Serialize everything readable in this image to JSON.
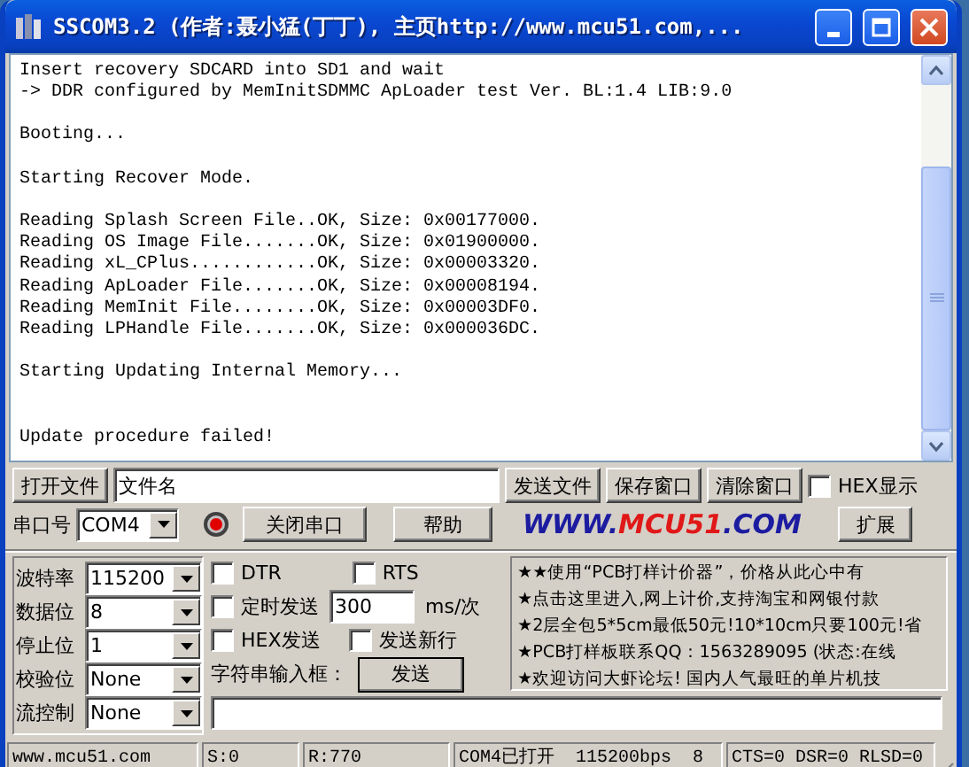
{
  "window": {
    "title": "SSCOM3.2 (作者:聂小猛(丁丁), 主页http://www.mcu51.com,..."
  },
  "terminal": {
    "blocks": [
      {
        "kind": "normal",
        "lines": [
          "Insert recovery SDCARD into SD1 and wait",
          "-> DDR configured by MemInitSDMMC ApLoader test Ver. BL:1.4 LIB:9.0"
        ]
      },
      {
        "kind": "normal",
        "lines": [
          "Booting..."
        ]
      },
      {
        "kind": "normal",
        "lines": [
          "Starting Recover Mode."
        ]
      },
      {
        "kind": "normal",
        "lines": [
          "Reading Splash Screen File..OK, Size: 0x00177000.",
          "Reading OS Image File.......OK, Size: 0x01900000.",
          "Reading xL_CPlus............OK, Size: 0x00003320.",
          "Reading ApLoader File.......OK, Size: 0x00008194.",
          "Reading MemInit File........OK, Size: 0x00003DF0.",
          "Reading LPHandle File.......OK, Size: 0x000036DC."
        ]
      },
      {
        "kind": "normal",
        "lines": [
          "Starting Updating Internal Memory..."
        ]
      },
      {
        "kind": "result",
        "lines": [
          "Update procedure failed!"
        ]
      }
    ]
  },
  "file_row": {
    "open_button": "打开文件",
    "filename": "文件名",
    "buttons": [
      "发送文件",
      "保存窗口",
      "清除窗口"
    ],
    "hex_display": {
      "label": "HEX显示",
      "checked": false
    }
  },
  "port_row": {
    "label": "串口号",
    "port": "COM4",
    "port_open": true,
    "close_button": "关闭串口",
    "help_button": "帮助",
    "logo": [
      {
        "text": "WWW.",
        "color": "#1c1ca0"
      },
      {
        "text": "MCU51",
        "color": "#e01818"
      },
      {
        "text": ".COM",
        "color": "#1c1ca0"
      }
    ],
    "expand_button": "扩展"
  },
  "settings": [
    {
      "label": "波特率",
      "value": "115200"
    },
    {
      "label": "数据位",
      "value": "8"
    },
    {
      "label": "停止位",
      "value": "1"
    },
    {
      "label": "校验位",
      "value": "None"
    },
    {
      "label": "流控制",
      "value": "None"
    }
  ],
  "options": {
    "dtr": {
      "label": "DTR",
      "checked": false
    },
    "rts": {
      "label": "RTS",
      "checked": false
    },
    "timed_send": {
      "label": "定时发送",
      "checked": false
    },
    "interval": "300",
    "interval_unit": "ms/次",
    "hex_send": {
      "label": "HEX发送",
      "checked": false
    },
    "send_newline": {
      "label": "发送新行",
      "checked": false
    },
    "input_label": "字符串输入框：",
    "send_button": "发送"
  },
  "ads": [
    "★★使用“PCB打样计价器”，价格从此心中有",
    "★点击这里进入,网上计价,支持淘宝和网银付款",
    "★2层全包5*5cm最低50元!10*10cm只要100元!省",
    "★PCB打样板联系QQ：1563289095 (状态:在线",
    "★欢迎访问大虾论坛! 国内人气最旺的单片机技"
  ],
  "status_bar": [
    "www.mcu51.com",
    "S:0",
    "R:770",
    "COM4已打开  115200bps  8",
    "CTS=0 DSR=0 RLSD=0"
  ]
}
